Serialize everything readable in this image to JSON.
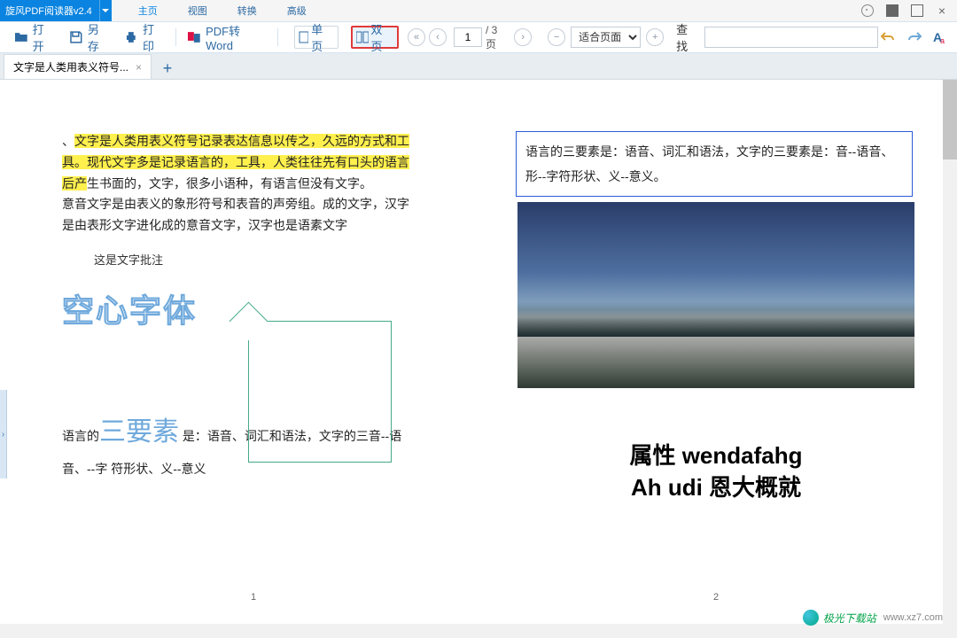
{
  "app_title": "旋风PDF阅读器v2.4",
  "menu": {
    "home": "主页",
    "view": "视图",
    "convert": "转换",
    "advanced": "高级"
  },
  "toolbar": {
    "open": "打开",
    "saveas": "另存",
    "print": "打印",
    "pdf2word": "PDF转Word",
    "single": "单页",
    "double": "双页",
    "page_current": "1",
    "page_total": "/ 3 页",
    "fit_label": "适合页面",
    "search_label": "查找"
  },
  "tab": {
    "name": "文字是人类用表义符号..."
  },
  "page1": {
    "para1_hl": "文字是人类用表义符号记录表达信息以传之，久远的方式和工具。现代文字多是记录语言的，工具，人类往往先有口头的语言后产",
    "para1_rest": "生书面的，文字，很多小语种，有语言但没有文字。",
    "para2": "意音文字是由表义的象形符号和表音的声旁组。成的文字，汉字是由表形文字进化成的意音文字，汉字也是语素文字",
    "anno": "这是文字批注",
    "hollow": "空心字体",
    "bottom_pre": "语言的",
    "bottom_big": "三要素",
    "bottom_post": " 是：语音、词汇和语法，文字的三音--语音、--字 符形状、义--意义",
    "num": "1"
  },
  "page2": {
    "box": "语言的三要素是：语音、词汇和语法，文字的三要素是：音--语音、形--字符形状、义--意义。",
    "big1": "属性 wendafahg",
    "big2": "Ah udi 恩大概就",
    "num": "2"
  },
  "watermark": {
    "text": "极光下载站",
    "url": "www.xz7.com"
  }
}
